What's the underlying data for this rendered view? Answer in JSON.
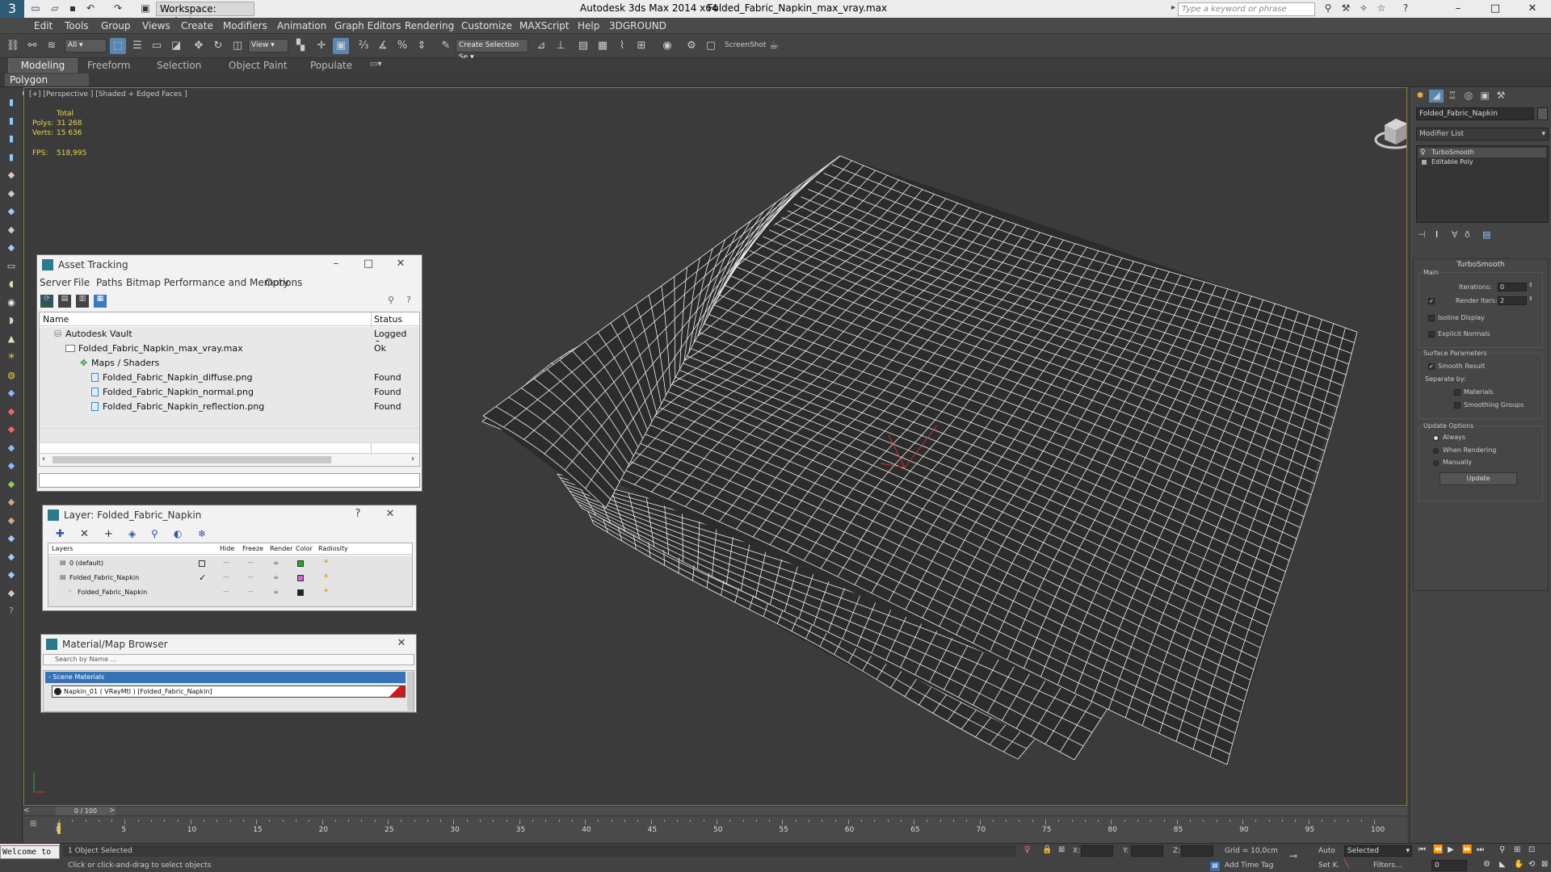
{
  "titlebar": {
    "workspace": "Workspace: Default",
    "app_title": "Autodesk 3ds Max  2014 x64",
    "file_title": "Folded_Fabric_Napkin_max_vray.max",
    "search_placeholder": "Type a keyword or phrase",
    "minimize": "–",
    "maximize": "□",
    "close": "✕"
  },
  "menu": [
    "Edit",
    "Tools",
    "Group",
    "Views",
    "Create",
    "Modifiers",
    "Animation",
    "Graph Editors",
    "Rendering",
    "Customize",
    "MAXScript",
    "Help",
    "3DGROUND"
  ],
  "toolbar": {
    "filter": "All",
    "refcoord": "View",
    "selection_set": "Create Selection Se",
    "screenshot": "ScreenShot"
  },
  "ribbon": {
    "tabs": [
      "Modeling",
      "Freeform",
      "Selection",
      "Object Paint",
      "Populate"
    ],
    "panel": "Polygon Modeling"
  },
  "viewport": {
    "label": "[+] [Perspective ] [Shaded + Edged Faces ]",
    "stats_header": "Total",
    "polys_label": "Polys:",
    "polys": "31 268",
    "verts_label": "Verts:",
    "verts": "15 636",
    "fps_label": "FPS:",
    "fps": "518,995"
  },
  "asset_tracking": {
    "title": "Asset Tracking",
    "menu": [
      "Server",
      "File",
      "Paths",
      "Bitmap Performance and Memory",
      "Options"
    ],
    "col_name": "Name",
    "col_status": "Status",
    "rows": [
      {
        "name": "Autodesk Vault",
        "status": "Logged O..."
      },
      {
        "name": "Folded_Fabric_Napkin_max_vray.max",
        "status": "Ok"
      },
      {
        "name": "Maps / Shaders",
        "status": ""
      },
      {
        "name": "Folded_Fabric_Napkin_diffuse.png",
        "status": "Found"
      },
      {
        "name": "Folded_Fabric_Napkin_normal.png",
        "status": "Found"
      },
      {
        "name": "Folded_Fabric_Napkin_reflection.png",
        "status": "Found"
      }
    ]
  },
  "layer": {
    "title": "Layer: Folded_Fabric_Napkin",
    "help": "?",
    "cols": [
      "Layers",
      "Hide",
      "Freeze",
      "Render",
      "Color",
      "Radiosity"
    ],
    "rows": [
      {
        "name": "0 (default)",
        "color": "#22aa22"
      },
      {
        "name": "Folded_Fabric_Napkin",
        "color": "#cc66cc"
      },
      {
        "name": "Folded_Fabric_Napkin",
        "color": "#222222"
      }
    ]
  },
  "material_browser": {
    "title": "Material/Map Browser",
    "search": "Search by Name ...",
    "group": "- Scene Materials",
    "item": "Napkin_01  ( VRayMtl )  [Folded_Fabric_Napkin]",
    "accent": "#cc1a1a"
  },
  "command_panel": {
    "object_name": "Folded_Fabric_Napkin",
    "modifier_list": "Modifier List",
    "stack": [
      "TurboSmooth",
      "Editable Poly"
    ],
    "turbosmooth": {
      "title": "TurboSmooth",
      "main": "Main",
      "iterations_label": "Iterations:",
      "iterations": "0",
      "render_iters_label": "Render Iters:",
      "render_iters": "2",
      "isoline": "Isoline Display",
      "explicit": "Explicit Normals",
      "surface": "Surface Parameters",
      "smooth_result": "Smooth Result",
      "separate": "Separate by:",
      "materials": "Materials",
      "smoothing": "Smoothing Groups",
      "update_options": "Update Options",
      "always": "Always",
      "when_rendering": "When Rendering",
      "manually": "Manually",
      "update": "Update"
    }
  },
  "timeline": {
    "frame": "0 / 100",
    "ticks": [
      "0",
      "5",
      "10",
      "15",
      "20",
      "25",
      "30",
      "35",
      "40",
      "45",
      "50",
      "55",
      "60",
      "65",
      "70",
      "75",
      "80",
      "85",
      "90",
      "95",
      "100"
    ]
  },
  "status": {
    "welcome": "Welcome to",
    "selected": "1 Object Selected",
    "prompt": "Click or click-and-drag to select objects",
    "x": "X:",
    "y": "Y:",
    "z": "Z:",
    "grid": "Grid = 10,0cm",
    "add_time_tag": "Add Time Tag",
    "auto": "Auto",
    "selected_mode": "Selected",
    "setk": "Set K.",
    "filters": "Filters...",
    "frame_field": "0"
  }
}
